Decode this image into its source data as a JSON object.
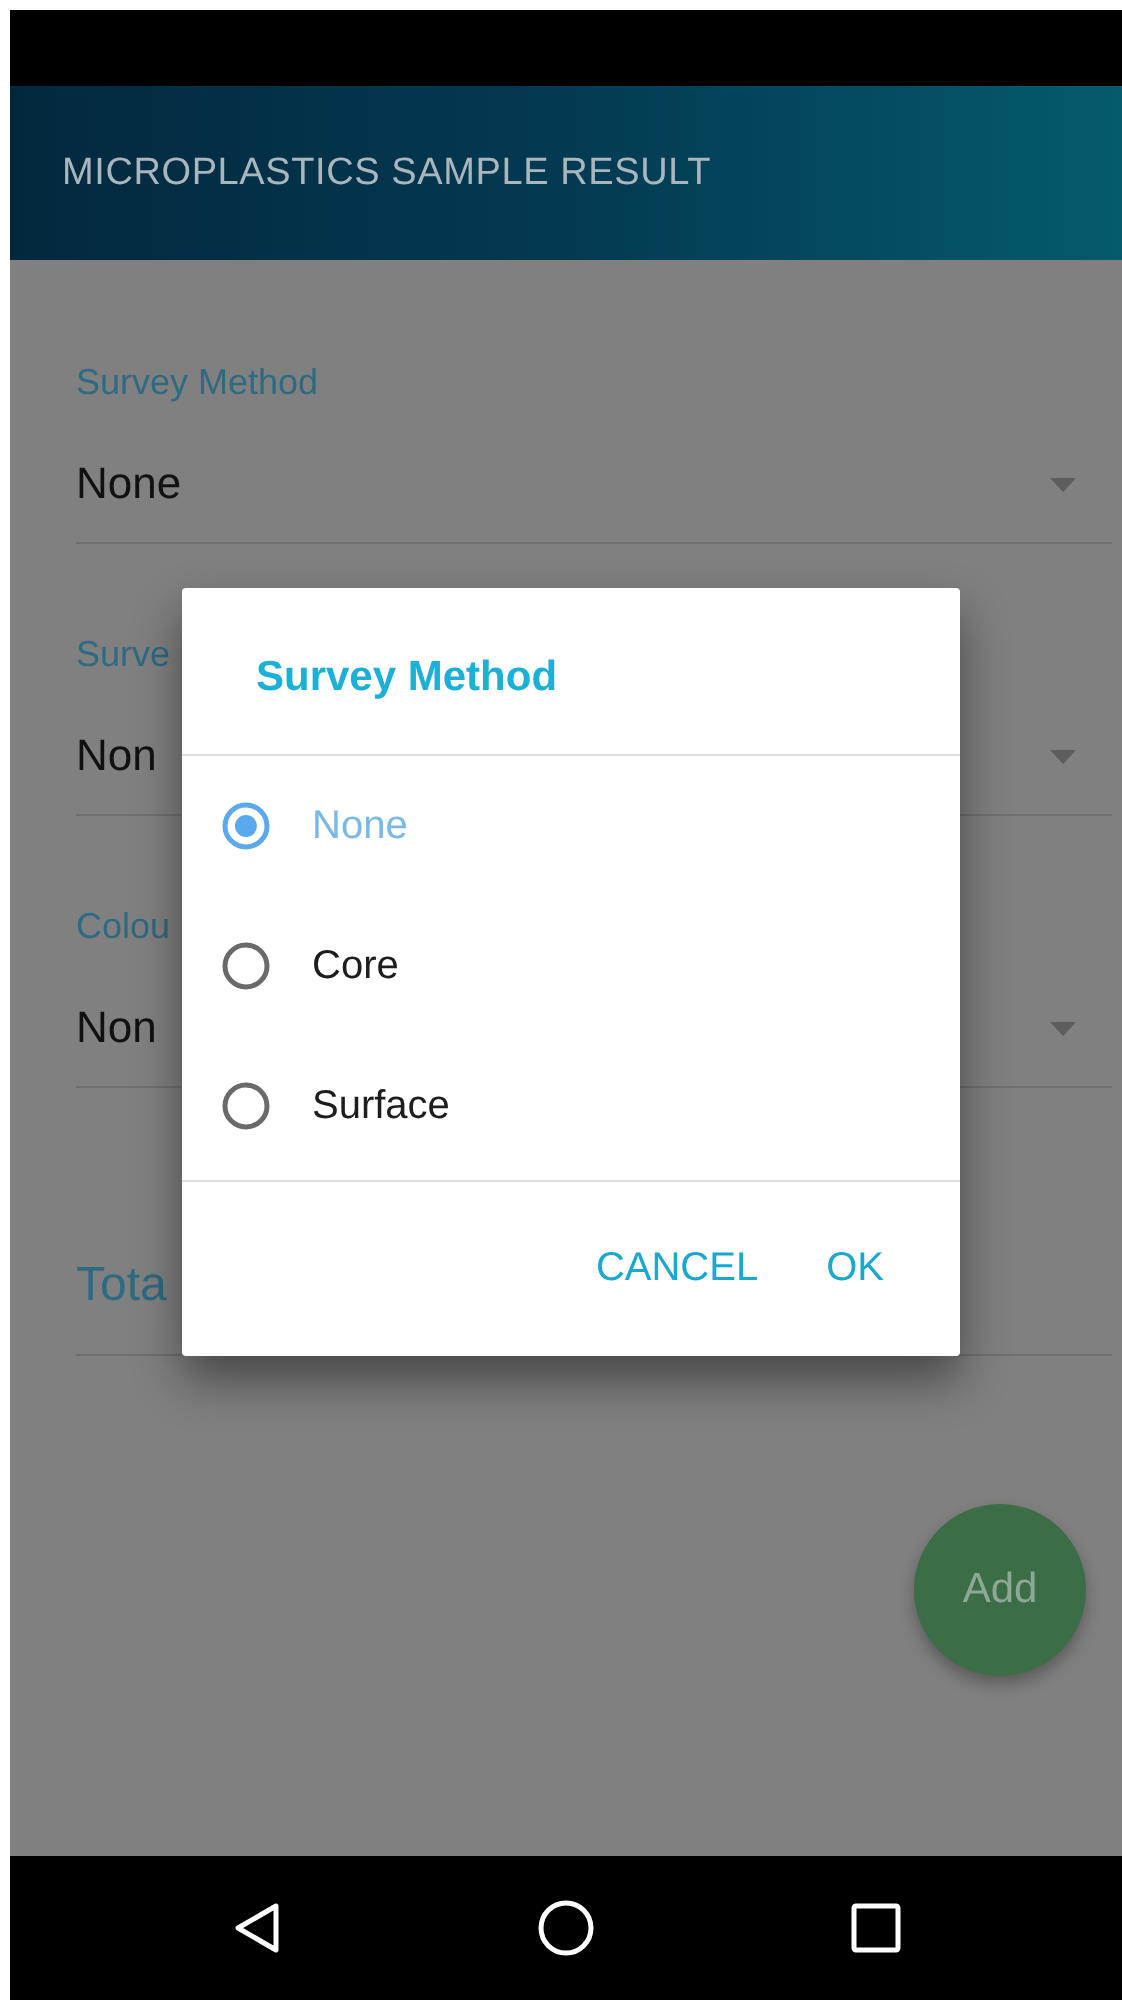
{
  "app_bar": {
    "title": "MICROPLASTICS SAMPLE RESULT"
  },
  "form": {
    "fields": [
      {
        "kind": "dropdown",
        "label": "Survey Method",
        "value": "None"
      },
      {
        "kind": "dropdown",
        "label": "Surve",
        "value": "Non"
      },
      {
        "kind": "dropdown",
        "label": "Colou",
        "value": "Non"
      },
      {
        "kind": "text",
        "label": "Tota"
      }
    ]
  },
  "fab": {
    "label": "Add"
  },
  "dialog": {
    "title": "Survey Method",
    "options": [
      {
        "label": "None",
        "selected": true
      },
      {
        "label": "Core",
        "selected": false
      },
      {
        "label": "Surface",
        "selected": false
      }
    ],
    "buttons": [
      "CANCEL",
      "OK"
    ]
  }
}
